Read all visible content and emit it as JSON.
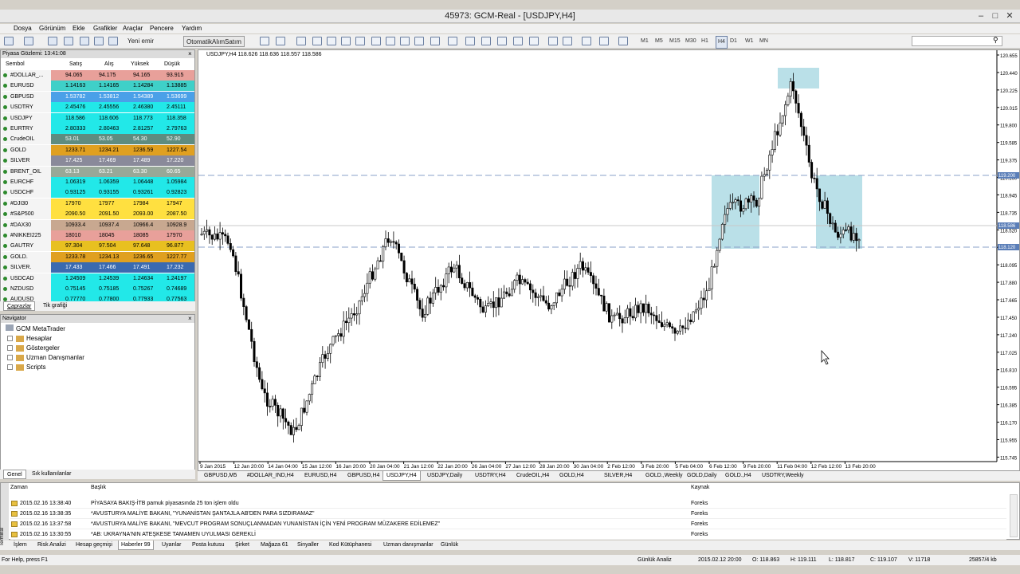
{
  "window": {
    "title": "45973: GCM-Real - [USDJPY,H4]"
  },
  "menu": [
    "Dosya",
    "Görünüm",
    "Ekle",
    "Grafikler",
    "Araçlar",
    "Pencere",
    "Yardım"
  ],
  "toolbar": {
    "new_order": "Yeni emir",
    "algo": "OtomatikAlımSatım",
    "timeframes": [
      "M1",
      "M5",
      "M15",
      "M30",
      "H1",
      "H4",
      "D1",
      "W1",
      "MN"
    ],
    "active_tf": "H4"
  },
  "market_watch": {
    "title": "Piyasa Gözlemi: 13:41:08",
    "columns": [
      "Sembol",
      "Satış",
      "Alış",
      "Yüksek",
      "Düşük"
    ],
    "rows": [
      {
        "sym": "#DOLLAR_...",
        "bid": "94.065",
        "ask": "94.175",
        "high": "94.165",
        "low": "93.915",
        "color": "#e8a09a"
      },
      {
        "sym": "EURUSD",
        "bid": "1.14163",
        "ask": "1.14165",
        "high": "1.14284",
        "low": "1.13885",
        "color": "#3fd0c8"
      },
      {
        "sym": "GBPUSD",
        "bid": "1.53782",
        "ask": "1.53812",
        "high": "1.54389",
        "low": "1.53699",
        "color": "#4aa0e8"
      },
      {
        "sym": "USDTRY",
        "bid": "2.45476",
        "ask": "2.45556",
        "high": "2.46380",
        "low": "2.45111",
        "color": "#22e8e8"
      },
      {
        "sym": "USDJPY",
        "bid": "118.586",
        "ask": "118.606",
        "high": "118.773",
        "low": "118.358",
        "color": "#22e8e8"
      },
      {
        "sym": "EURTRY",
        "bid": "2.80333",
        "ask": "2.80463",
        "high": "2.81257",
        "low": "2.79763",
        "color": "#22e8e8"
      },
      {
        "sym": "CrudeOIL",
        "bid": "53.01",
        "ask": "53.05",
        "high": "54.30",
        "low": "52.90",
        "color": "#5e8c80"
      },
      {
        "sym": "GOLD",
        "bid": "1233.71",
        "ask": "1234.21",
        "high": "1236.59",
        "low": "1227.54",
        "color": "#e0a020"
      },
      {
        "sym": "SILVER",
        "bid": "17.425",
        "ask": "17.469",
        "high": "17.489",
        "low": "17.220",
        "color": "#8a8a9a"
      },
      {
        "sym": "BRENT_OIL",
        "bid": "63.13",
        "ask": "63.21",
        "high": "63.30",
        "low": "60.65",
        "color": "#98a898"
      },
      {
        "sym": "EURCHF",
        "bid": "1.06319",
        "ask": "1.06359",
        "high": "1.06448",
        "low": "1.05984",
        "color": "#22e8e8"
      },
      {
        "sym": "USDCHF",
        "bid": "0.93125",
        "ask": "0.93155",
        "high": "0.93261",
        "low": "0.92823",
        "color": "#22e8e8"
      },
      {
        "sym": "#DJI30",
        "bid": "17970",
        "ask": "17977",
        "high": "17984",
        "low": "17947",
        "color": "#ffe040"
      },
      {
        "sym": "#S&P500",
        "bid": "2090.50",
        "ask": "2091.50",
        "high": "2093.00",
        "low": "2087.50",
        "color": "#ffe040"
      },
      {
        "sym": "#DAX30",
        "bid": "10933.4",
        "ask": "10937.4",
        "high": "10966.4",
        "low": "10928.9",
        "color": "#c8a890"
      },
      {
        "sym": "#NIKKEI225",
        "bid": "18010",
        "ask": "18045",
        "high": "18085",
        "low": "17970",
        "color": "#e8a09a"
      },
      {
        "sym": "GAUTRY",
        "bid": "97.304",
        "ask": "97.504",
        "high": "97.648",
        "low": "96.877",
        "color": "#e8c020"
      },
      {
        "sym": "GOLD.",
        "bid": "1233.78",
        "ask": "1234.13",
        "high": "1236.65",
        "low": "1227.77",
        "color": "#e0a020"
      },
      {
        "sym": "SILVER.",
        "bid": "17.433",
        "ask": "17.466",
        "high": "17.491",
        "low": "17.232",
        "color": "#3a6ab0"
      },
      {
        "sym": "USDCAD",
        "bid": "1.24509",
        "ask": "1.24539",
        "high": "1.24634",
        "low": "1.24197",
        "color": "#22e8e8"
      },
      {
        "sym": "NZDUSD",
        "bid": "0.75145",
        "ask": "0.75185",
        "high": "0.75267",
        "low": "0.74689",
        "color": "#22e8e8"
      },
      {
        "sym": "AUDUSD",
        "bid": "0.77770",
        "ask": "0.77800",
        "high": "0.77933",
        "low": "0.77563",
        "color": "#22e8e8"
      }
    ],
    "tabs": [
      "Çaprazlar",
      "Tik grafiği"
    ]
  },
  "navigator": {
    "title": "Navigator",
    "root": "GCM MetaTrader",
    "items": [
      "Hesaplar",
      "Göstergeler",
      "Uzman Danışmanlar",
      "Scripts"
    ],
    "tabs": [
      "Genel",
      "Sık kullanılanlar"
    ]
  },
  "chart": {
    "header": "USDJPY,H4  118.626 118.636 118.557 118.586",
    "yticks": [
      "120.655",
      "120.440",
      "120.225",
      "120.015",
      "119.800",
      "119.585",
      "119.375",
      "119.160",
      "118.945",
      "118.735",
      "118.520",
      "118.305",
      "118.095",
      "117.880",
      "117.665",
      "117.450",
      "117.240",
      "117.025",
      "116.810",
      "116.595",
      "116.385",
      "116.170",
      "115.955",
      "115.745"
    ],
    "xticks": [
      "9 Jan 2015",
      "12 Jan 20:00",
      "14 Jan 04:00",
      "15 Jan 12:00",
      "16 Jan 20:00",
      "20 Jan 04:00",
      "21 Jan 12:00",
      "22 Jan 20:00",
      "26 Jan 04:00",
      "27 Jan 12:00",
      "28 Jan 20:00",
      "30 Jan 04:00",
      "2 Feb 12:00",
      "3 Feb 20:00",
      "5 Feb 04:00",
      "6 Feb 12:00",
      "9 Feb 20:00",
      "11 Feb 04:00",
      "12 Feb 12:00",
      "13 Feb 20:00"
    ],
    "hline_upper": "119.200",
    "current_price": "118.586",
    "hline_lower": "118.120"
  },
  "chart_tabs": [
    "GBPUSD,M5",
    "#DOLLAR_IND,H4",
    "EURUSD,H4",
    "GBPUSD,H4",
    "USDJPY,H4",
    "USDJPY,Daily",
    "USDTRY,H4",
    "CrudeOIL,H4",
    "GOLD,H4",
    "SILVER,H4",
    "GOLD.,Weekly",
    "GOLD,Daily",
    "GOLD.,H4",
    "USDTRY,Weekly"
  ],
  "active_chart_tab": "USDJPY,H4",
  "terminal": {
    "columns": [
      "Zaman",
      "Başlık",
      "Kaynak"
    ],
    "rows": [
      {
        "time": "2015.02.16 13:38:40",
        "title": "PİYASAYA BAKIŞ-İTB pamuk piyasasında 25 ton işlem oldu",
        "src": "Foreks"
      },
      {
        "time": "2015.02.16 13:38:35",
        "title": "*AVUSTURYA MALİYE BAKANI, \"YUNANİSTAN ŞANTAJLA AB'DEN PARA SIZDIRAMAZ\"",
        "src": "Foreks"
      },
      {
        "time": "2015.02.16 13:37:58",
        "title": "*AVUSTURYA MALİYE BAKANI, \"MEVCUT PROGRAM SONUÇLANMADAN YUNANİSTAN İÇİN YENİ PROGRAM MÜZAKERE EDİLEMEZ\"",
        "src": "Foreks"
      },
      {
        "time": "2015.02.16 13:30:55",
        "title": "*AB: UKRAYNA'NIN ATEŞKESE TAMAMEN UYULMASI GEREKLİ",
        "src": "Foreks"
      }
    ],
    "tabs": [
      "İşlem",
      "Risk Analizi",
      "Hesap geçmişi",
      "Haberler 99",
      "Uyarılar",
      "Posta kutusu",
      "Şirket",
      "Mağaza 61",
      "Sinyaller",
      "Kod Kütüphanesi",
      "Uzman danışmanlar",
      "Günlük"
    ],
    "active_tab": "Haberler 99",
    "side_label": "Terminal"
  },
  "status": {
    "help": "For Help, press F1",
    "profile": "Günlük Analiz",
    "date": "2015.02.12 20:00",
    "open": "O: 118.863",
    "high": "H: 119.111",
    "low": "L: 118.817",
    "close": "C: 119.107",
    "vol": "V: 11718",
    "conn": "25857/4 kb"
  }
}
